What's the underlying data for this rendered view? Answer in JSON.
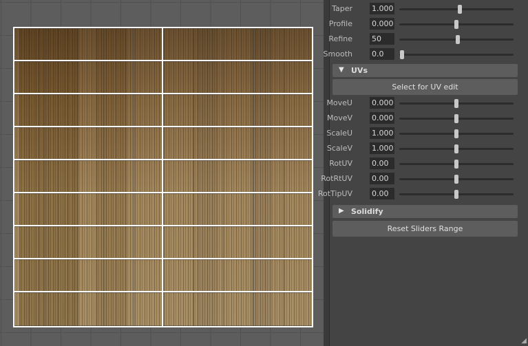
{
  "viewport": {
    "label": "uv-texture-viewport"
  },
  "panel": {
    "sliders_top": [
      {
        "label": "Taper",
        "value": "1.000",
        "level": 0.53
      },
      {
        "label": "Profile",
        "value": "0.000",
        "level": 0.5
      },
      {
        "label": "Refine",
        "value": "50",
        "level": 0.51
      },
      {
        "label": "Smooth",
        "value": "0.0",
        "level": 0.0
      }
    ],
    "uvs_section": {
      "title": "UVs",
      "expanded": true,
      "arrow": "▼",
      "select_button": "Select for UV edit",
      "sliders": [
        {
          "label": "MoveU",
          "value": "0.000",
          "level": 0.5
        },
        {
          "label": "MoveV",
          "value": "0.000",
          "level": 0.5
        },
        {
          "label": "ScaleU",
          "value": "1.000",
          "level": 0.5
        },
        {
          "label": "ScaleV",
          "value": "1.000",
          "level": 0.5
        },
        {
          "label": "RotUV",
          "value": "0.00",
          "level": 0.5
        },
        {
          "label": "RotRtUV",
          "value": "0.00",
          "level": 0.5
        },
        {
          "label": "RotTipUV",
          "value": "0.00",
          "level": 0.5
        }
      ]
    },
    "solidify_section": {
      "title": "Solidify",
      "expanded": false,
      "arrow": "▶"
    },
    "reset_button": "Reset Sliders Range"
  },
  "colors": {
    "panel_bg": "#444444",
    "header_bg": "#5d5d5d",
    "field_bg": "#2b2b2b",
    "uv_border": "#ffffff"
  }
}
